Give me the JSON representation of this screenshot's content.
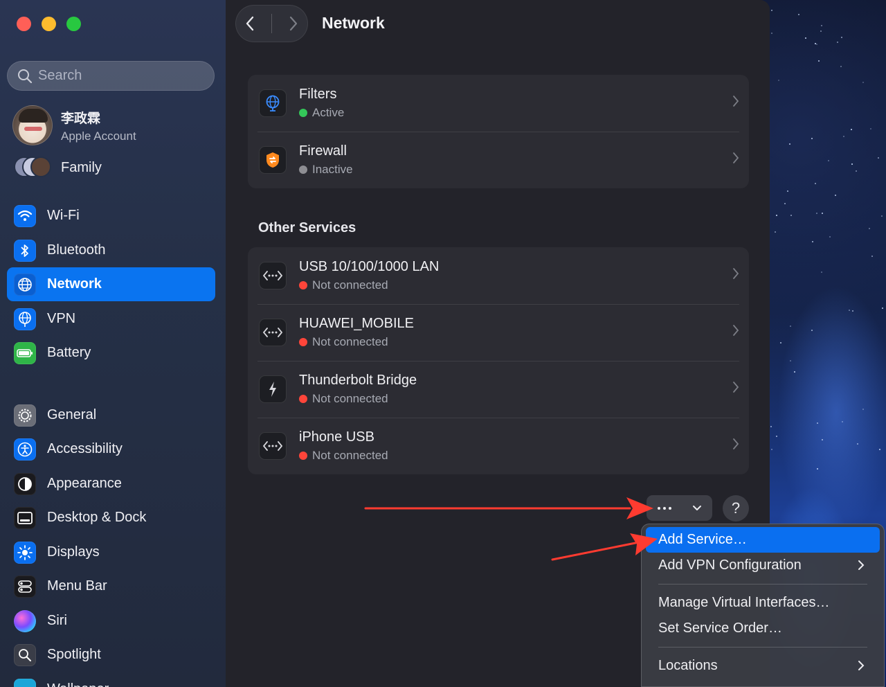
{
  "sidebar": {
    "search_placeholder": "Search",
    "account": {
      "name": "李政霖",
      "subtitle": "Apple Account"
    },
    "family_label": "Family",
    "items": [
      {
        "label": "Wi-Fi",
        "icon": "wifi-icon"
      },
      {
        "label": "Bluetooth",
        "icon": "bluetooth-icon"
      },
      {
        "label": "Network",
        "icon": "globe-icon",
        "active": true
      },
      {
        "label": "VPN",
        "icon": "vpn-globe-icon"
      },
      {
        "label": "Battery",
        "icon": "battery-icon"
      },
      {
        "label": "General",
        "icon": "gear-icon"
      },
      {
        "label": "Accessibility",
        "icon": "accessibility-icon"
      },
      {
        "label": "Appearance",
        "icon": "appearance-icon"
      },
      {
        "label": "Desktop & Dock",
        "icon": "desktop-dock-icon"
      },
      {
        "label": "Displays",
        "icon": "sun-icon"
      },
      {
        "label": "Menu Bar",
        "icon": "menu-bar-icon"
      },
      {
        "label": "Siri",
        "icon": "siri-icon"
      },
      {
        "label": "Spotlight",
        "icon": "magnifier-icon"
      },
      {
        "label": "Wallpaper",
        "icon": "wallpaper-icon"
      }
    ]
  },
  "header": {
    "title": "Network"
  },
  "top_services": [
    {
      "name": "Filters",
      "status": "Active",
      "status_color": "#34c759",
      "icon": "filters-globe-icon"
    },
    {
      "name": "Firewall",
      "status": "Inactive",
      "status_color": "#8e8e93",
      "icon": "firewall-shield-icon"
    }
  ],
  "other_services": {
    "label": "Other Services",
    "items": [
      {
        "name": "USB 10/100/1000 LAN",
        "status": "Not connected",
        "status_color": "#ff453a",
        "icon": "ethernet-icon"
      },
      {
        "name": "HUAWEI_MOBILE",
        "status": "Not connected",
        "status_color": "#ff453a",
        "icon": "ethernet-icon"
      },
      {
        "name": "Thunderbolt Bridge",
        "status": "Not connected",
        "status_color": "#ff453a",
        "icon": "thunderbolt-icon"
      },
      {
        "name": "iPhone USB",
        "status": "Not connected",
        "status_color": "#ff453a",
        "icon": "ethernet-icon"
      }
    ]
  },
  "toolbar": {
    "more_icon": "ellipsis-icon",
    "help_label": "?"
  },
  "menu": {
    "items": [
      {
        "label": "Add Service…",
        "highlight": true
      },
      {
        "label": "Add VPN Configuration",
        "submenu": true
      },
      {
        "label": "Manage Virtual Interfaces…"
      },
      {
        "label": "Set Service Order…"
      },
      {
        "label": "Locations",
        "submenu": true
      }
    ]
  },
  "colors": {
    "accent": "#0a74f0",
    "annotation_arrow": "#ff3b30"
  }
}
